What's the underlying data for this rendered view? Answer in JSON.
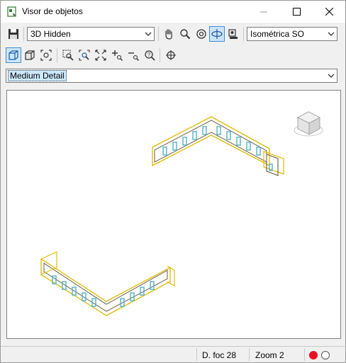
{
  "window": {
    "title": "Visor de objetos"
  },
  "toolbar": {
    "visual_style": "3D Hidden",
    "view": "Isométrica SO"
  },
  "detail_level": "Medium Detail",
  "status": {
    "focal_distance": "D. foc 28",
    "zoom": "Zoom 2"
  },
  "colors": {
    "accent": "#3d8fd8",
    "active_bg": "#cce4f7",
    "record_red": "#e81123",
    "wall_yellow": "#e0b800",
    "wall_dark": "#5a4a2a",
    "window_cyan": "#4fb3c9"
  },
  "icons": [
    "save-icon",
    "pan-hand-icon",
    "zoom-icon",
    "zoom-object-icon",
    "orbit-icon",
    "camera-icon",
    "wireframe-cube-icon",
    "shaded-cube-icon",
    "zoom-fit-icon",
    "zoom-window-icon",
    "zoom-region-icon",
    "zoom-extents-icon",
    "zoom-in-icon",
    "zoom-out-icon",
    "zoom-previous-icon",
    "target-icon",
    "viewcube-icon"
  ]
}
